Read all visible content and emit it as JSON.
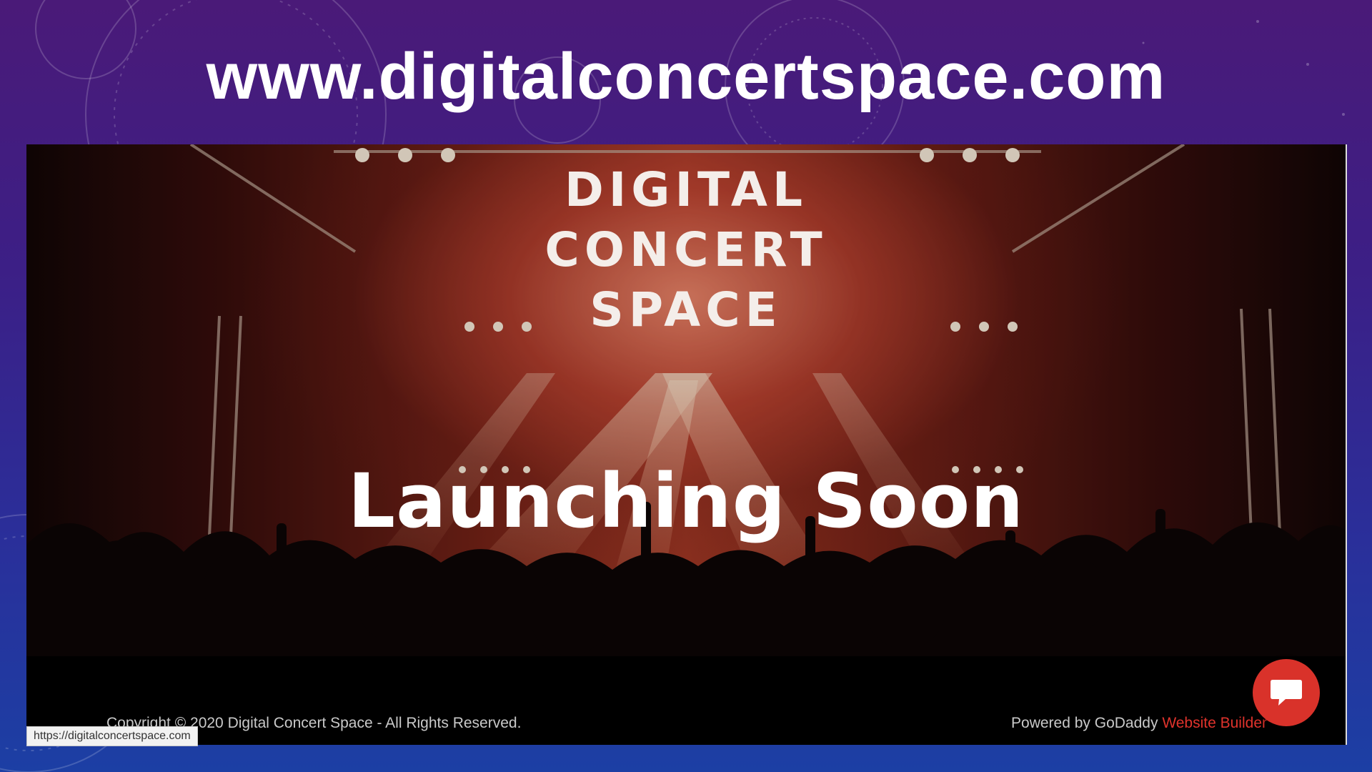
{
  "slide": {
    "title": "www.digitalconcertspace.com"
  },
  "site": {
    "logo_lines": [
      "DIGITAL",
      "CONCERT",
      "SPACE"
    ],
    "headline": "Launching Soon",
    "footer": {
      "copyright": "Copyright © 2020 Digital Concert Space - All Rights Reserved.",
      "powered_prefix": "Powered by GoDaddy ",
      "powered_link": "Website Builder"
    },
    "chat_icon": "chat-bubble-icon"
  },
  "status_bar": {
    "url": "https://digitalconcertspace.com"
  },
  "colors": {
    "accent_red": "#d9322a",
    "link_red": "#e0332c"
  }
}
